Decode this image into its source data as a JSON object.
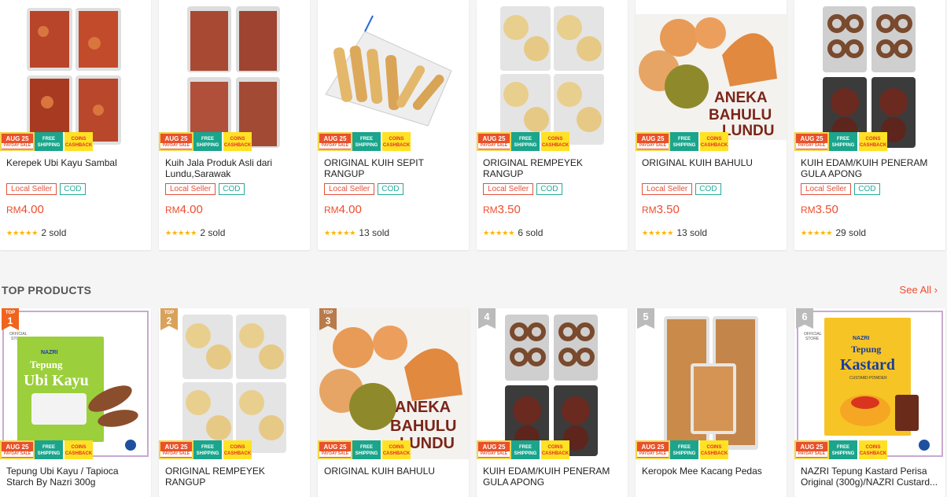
{
  "badges": {
    "aug": "AUG 25",
    "aug_sub": "PAYDAY SALE",
    "free": "FREE SHIPPING",
    "coins": "COINS CASHBACK"
  },
  "tags": {
    "local": "Local Seller",
    "cod": "COD"
  },
  "stars": "★★★★★",
  "row1": [
    {
      "title": "Kerepek Ubi Kayu Sambal",
      "currency": "RM",
      "price": "4.00",
      "sold": "2 sold"
    },
    {
      "title": "Kuih Jala Produk Asli dari Lundu,Sarawak",
      "currency": "RM",
      "price": "4.00",
      "sold": "2 sold"
    },
    {
      "title": "ORIGINAL KUIH SEPIT RANGUP",
      "currency": "RM",
      "price": "4.00",
      "sold": "13 sold"
    },
    {
      "title": "ORIGINAL REMPEYEK RANGUP",
      "currency": "RM",
      "price": "3.50",
      "sold": "6 sold"
    },
    {
      "title": "ORIGINAL KUIH BAHULU",
      "currency": "RM",
      "price": "3.50",
      "sold": "13 sold"
    },
    {
      "title": "KUIH EDAM/KUIH PENERAM GULA APONG",
      "currency": "RM",
      "price": "3.50",
      "sold": "29 sold"
    }
  ],
  "section": {
    "title": "TOP PRODUCTS",
    "see_all": "See All"
  },
  "rank_top_label": "TOP",
  "row2": [
    {
      "rank": "1",
      "title": "Tepung Ubi Kayu / Tapioca Starch By Nazri 300g"
    },
    {
      "rank": "2",
      "title": "ORIGINAL REMPEYEK RANGUP"
    },
    {
      "rank": "3",
      "title": "ORIGINAL KUIH BAHULU"
    },
    {
      "rank": "4",
      "title": "KUIH EDAM/KUIH PENERAM GULA APONG"
    },
    {
      "rank": "5",
      "title": "Keropok Mee Kacang Pedas"
    },
    {
      "rank": "6",
      "title": "NAZRI Tepung Kastard Perisa Original (300g)/NAZRI Custard..."
    }
  ],
  "image_text": {
    "aneka": "ANEKA BAHULU LUNDU",
    "brand": "NAZRI",
    "tepung": "Tepung",
    "ubi_kayu": "Ubi Kayu",
    "kastard": "Kastard",
    "custard_powder": "CUSTARD POWDER",
    "official_store": "OFFICIAL STORE"
  },
  "colors": {
    "accent": "#ee4d2d",
    "cod": "#26aa99",
    "star": "#ffb400"
  }
}
